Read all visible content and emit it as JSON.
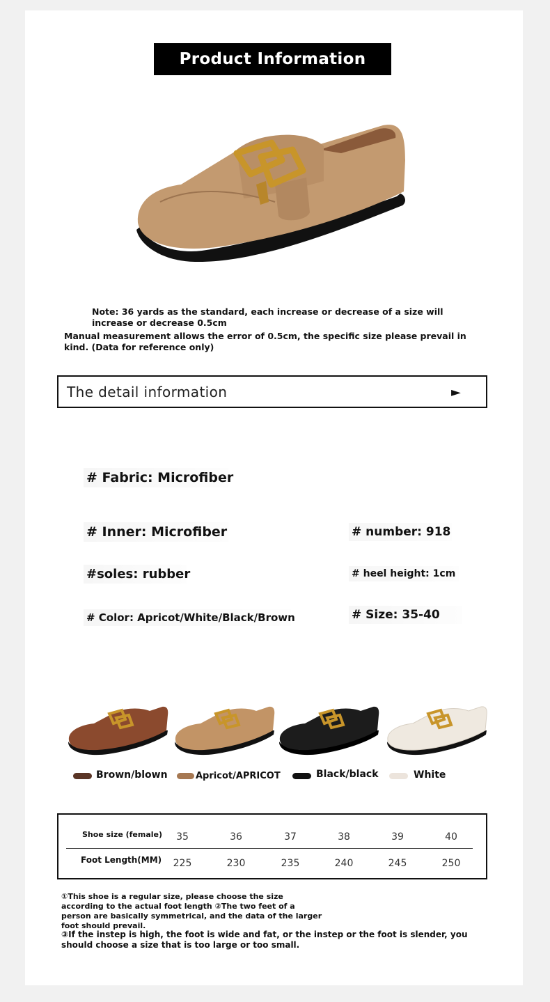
{
  "header": {
    "title": "Product Information"
  },
  "notes": {
    "note1": "Note: 36 yards as the standard, each increase or decrease of a size will increase or decrease 0.5cm",
    "note2": "Manual measurement allows the error of 0.5cm, the specific size please prevail in kind. (Data for reference only)"
  },
  "detail": {
    "label": "The  detail  information",
    "arrow": "►"
  },
  "specs": {
    "fabric": "# Fabric: Microfiber",
    "inner": "# Inner: Microfiber",
    "number": "# number: 918",
    "soles": "#soles: rubber",
    "heel": "# heel height: 1cm",
    "color": "# Color: Apricot/White/Black/Brown",
    "size": "# Size: 35-40"
  },
  "variants": [
    {
      "label": "Brown/blown",
      "color": "#5a3526",
      "shoe": "#8b4a2e"
    },
    {
      "label": "Apricot/APRICOT",
      "color": "#a67852",
      "shoe": "#c29466"
    },
    {
      "label": "Black/black",
      "color": "#111111",
      "shoe": "#1c1c1c"
    },
    {
      "label": "White",
      "color": "#ece4dc",
      "shoe": "#efe9e0"
    }
  ],
  "size_table": {
    "row1_header": "Shoe size (female)",
    "row2_header": "Foot Length(MM)",
    "sizes": [
      "35",
      "36",
      "37",
      "38",
      "39",
      "40"
    ],
    "lengths": [
      "225",
      "230",
      "235",
      "240",
      "245",
      "250"
    ]
  },
  "footnotes": {
    "f1": "①This shoe is a regular size, please choose the size according to the actual foot length ②The two feet of a person are basically symmetrical, and the data of the larger foot should prevail.",
    "f2": "③If the instep is high, the foot is wide and fat, or the instep or the foot is slender, you should choose a size that is too large or too small."
  }
}
